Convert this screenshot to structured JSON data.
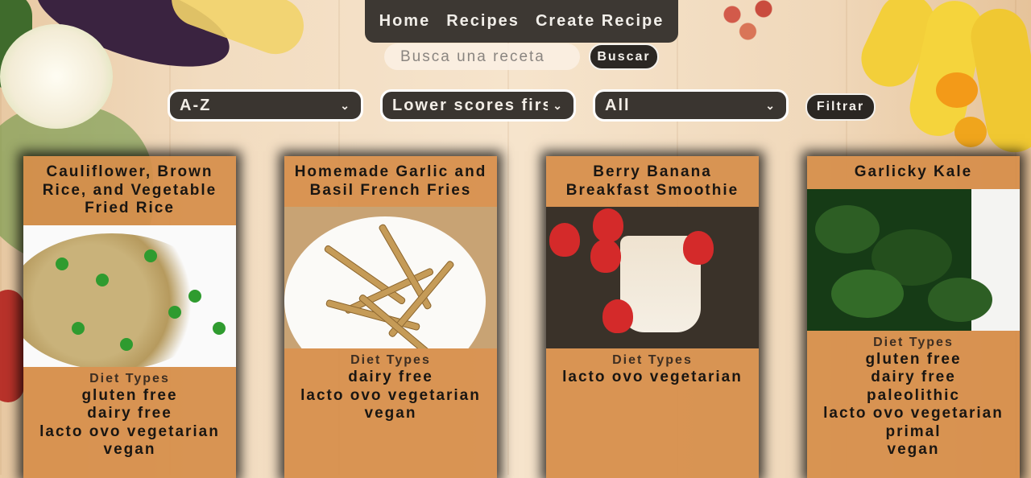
{
  "nav": {
    "items": [
      "Home",
      "Recipes",
      "Create Recipe"
    ]
  },
  "search": {
    "placeholder": "Busca una receta",
    "button": "Buscar"
  },
  "filters": {
    "order": "A-Z",
    "score": "Lower scores first",
    "diet": "All",
    "button": "Filtrar"
  },
  "cards": [
    {
      "title": "Cauliflower, Brown Rice, and Vegetable Fried Rice",
      "diet_label": "Diet Types",
      "diets": [
        "gluten free",
        "dairy free",
        "lacto ovo vegetarian",
        "vegan"
      ]
    },
    {
      "title": "Homemade Garlic and Basil French Fries",
      "diet_label": "Diet Types",
      "diets": [
        "dairy free",
        "lacto ovo vegetarian",
        "vegan"
      ]
    },
    {
      "title": "Berry Banana Breakfast Smoothie",
      "diet_label": "Diet Types",
      "diets": [
        "lacto ovo vegetarian"
      ]
    },
    {
      "title": "Garlicky Kale",
      "diet_label": "Diet Types",
      "diets": [
        "gluten free",
        "dairy free",
        "paleolithic",
        "lacto ovo vegetarian",
        "primal",
        "vegan"
      ]
    }
  ]
}
